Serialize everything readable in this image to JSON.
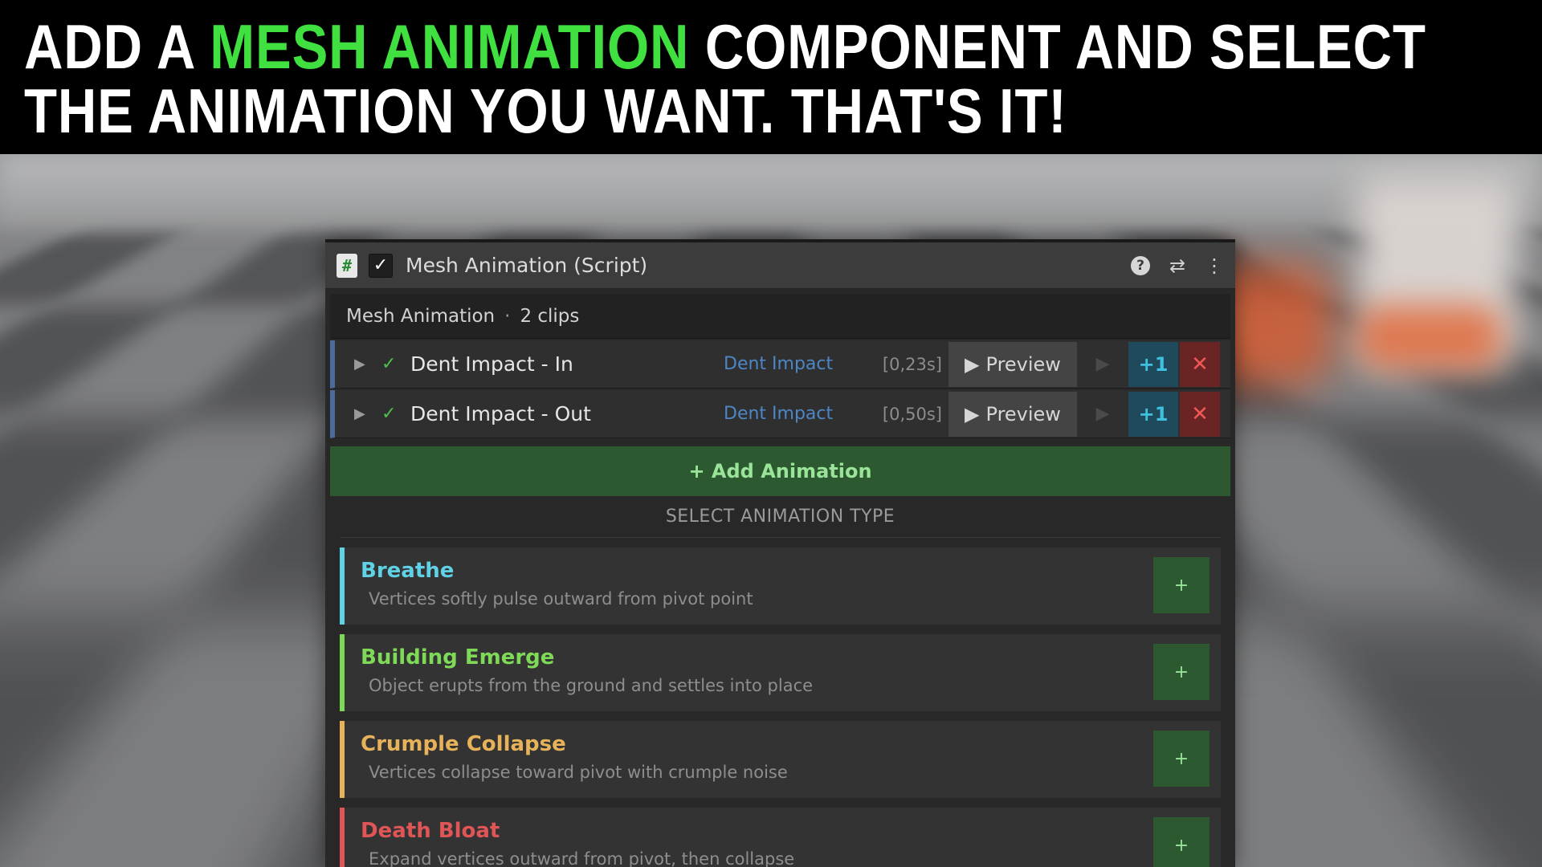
{
  "headline": {
    "part1": "ADD A ",
    "highlight": "MESH ANIMATION",
    "part2": " COMPONENT AND SELECT",
    "line2": "THE ANIMATION YOU WANT. THAT'S IT!",
    "highlight_color": "#3fe03f"
  },
  "component": {
    "icon": "script-hash-icon",
    "icon_glyph": "#",
    "enabled_glyph": "✓",
    "title": "Mesh Animation (Script)",
    "header_icons": [
      "help-icon",
      "presets-icon",
      "more-vertical-icon"
    ]
  },
  "summary": {
    "label": "Mesh Animation",
    "separator": "·",
    "count": "2 clips"
  },
  "clips": [
    {
      "name": "Dent Impact - In",
      "type": "Dent Impact",
      "duration": "[0,23s]",
      "preview_label": "Preview",
      "plus_label": "+1",
      "accent": "#4a6b99"
    },
    {
      "name": "Dent Impact - Out",
      "type": "Dent Impact",
      "duration": "[0,50s]",
      "preview_label": "Preview",
      "plus_label": "+1",
      "accent": "#4a6b99"
    }
  ],
  "add_animation_label": "+ Add Animation",
  "select_title": "SELECT ANIMATION TYPE",
  "animation_types": [
    {
      "name": "Breathe",
      "description": "Vertices softly pulse outward from pivot point",
      "color": "#5fd2e6",
      "add_label": "+"
    },
    {
      "name": "Building Emerge",
      "description": "Object erupts from the ground and settles into place",
      "color": "#7ed957",
      "add_label": "+"
    },
    {
      "name": "Crumple Collapse",
      "description": "Vertices collapse toward pivot with crumple noise",
      "color": "#e6b25a",
      "add_label": "+"
    },
    {
      "name": "Death Bloat",
      "description": "Expand vertices outward from pivot, then collapse",
      "color": "#e05555",
      "add_label": "+"
    }
  ]
}
